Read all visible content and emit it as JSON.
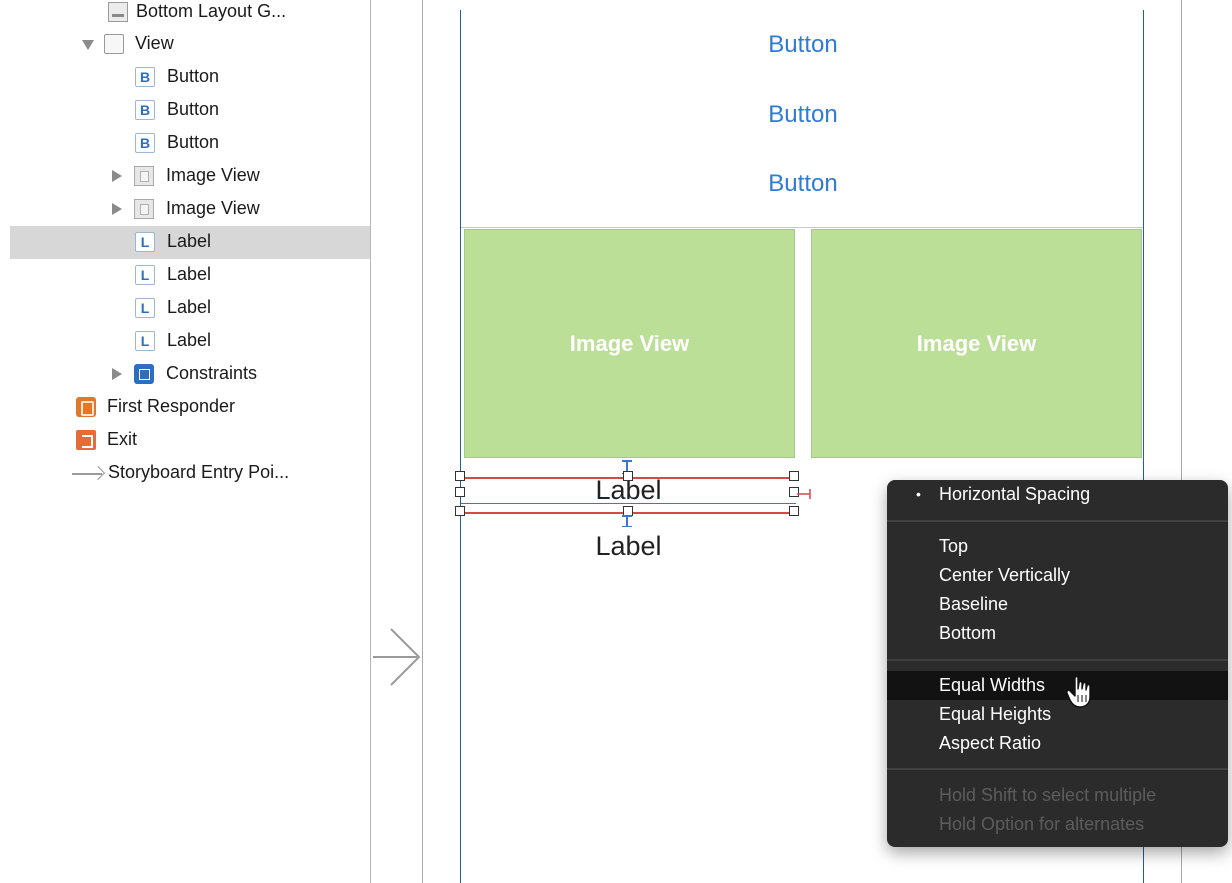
{
  "outline": {
    "items": [
      {
        "label": "Bottom Layout G...",
        "icon": "layout-guide-icon"
      },
      {
        "label": "View",
        "icon": "view-icon",
        "disclosure": "expanded"
      },
      {
        "label": "Button",
        "icon": "button-icon",
        "icon_letter": "B"
      },
      {
        "label": "Button",
        "icon": "button-icon",
        "icon_letter": "B"
      },
      {
        "label": "Button",
        "icon": "button-icon",
        "icon_letter": "B"
      },
      {
        "label": "Image View",
        "icon": "image-view-icon",
        "disclosure": "collapsed"
      },
      {
        "label": "Image View",
        "icon": "image-view-icon",
        "disclosure": "collapsed"
      },
      {
        "label": "Label",
        "icon": "label-icon",
        "icon_letter": "L",
        "selected": true
      },
      {
        "label": "Label",
        "icon": "label-icon",
        "icon_letter": "L"
      },
      {
        "label": "Label",
        "icon": "label-icon",
        "icon_letter": "L"
      },
      {
        "label": "Label",
        "icon": "label-icon",
        "icon_letter": "L"
      },
      {
        "label": "Constraints",
        "icon": "constraints-icon",
        "disclosure": "collapsed"
      },
      {
        "label": "First Responder",
        "icon": "first-responder-icon"
      },
      {
        "label": "Exit",
        "icon": "exit-icon"
      },
      {
        "label": "Storyboard Entry Poi...",
        "icon": "entry-point-arrow-icon"
      }
    ]
  },
  "canvas": {
    "buttons": [
      "Button",
      "Button",
      "Button"
    ],
    "image_views": [
      "Image View",
      "Image View"
    ],
    "labels": [
      "Label",
      "Label"
    ],
    "colors": {
      "button_text": "#2f7bd6",
      "image_view_fill": "#bcdf98",
      "constraint_red": "#d34a4a",
      "scene_border": "#1f5ea8"
    }
  },
  "menu": {
    "items": [
      {
        "label": "Horizontal Spacing",
        "bullet": "•",
        "group": 1
      },
      {
        "label": "Top",
        "group": 2
      },
      {
        "label": "Center Vertically",
        "group": 2
      },
      {
        "label": "Baseline",
        "group": 2
      },
      {
        "label": "Bottom",
        "group": 2
      },
      {
        "label": "Equal Widths",
        "group": 3,
        "highlighted": true
      },
      {
        "label": "Equal Heights",
        "group": 3
      },
      {
        "label": "Aspect Ratio",
        "group": 3
      },
      {
        "label": "Hold Shift to select multiple",
        "group": 4,
        "disabled": true
      },
      {
        "label": "Hold Option for alternates",
        "group": 4,
        "disabled": true
      }
    ]
  }
}
